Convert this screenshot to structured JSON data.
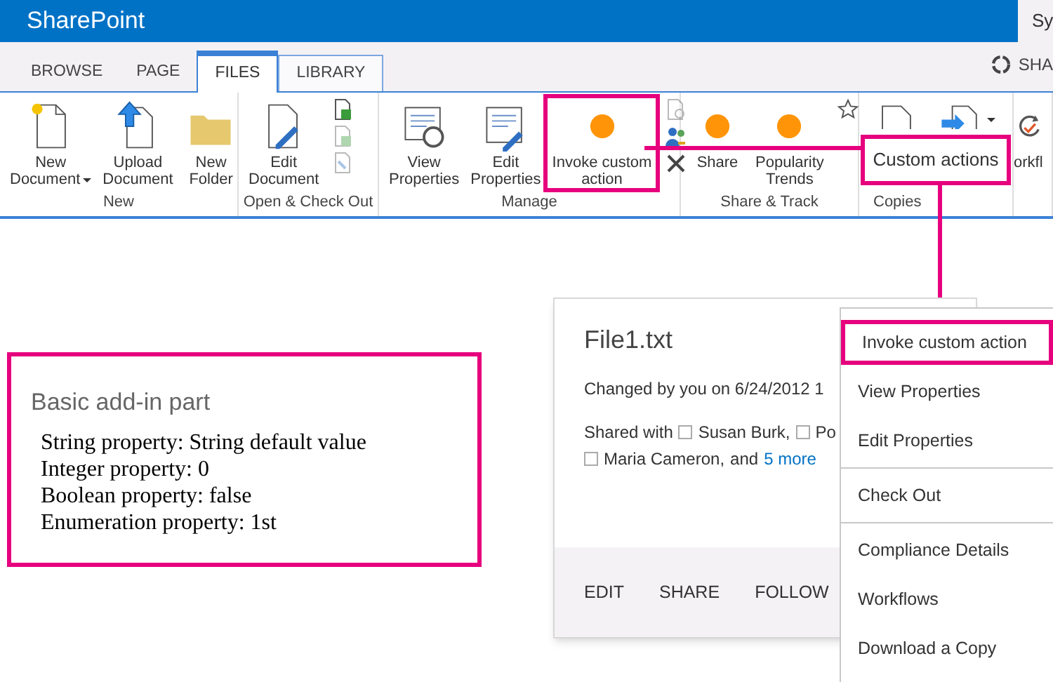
{
  "app_title": "SharePoint",
  "top_right_text": "Sy",
  "tabs": [
    {
      "label": "BROWSE",
      "selected": false
    },
    {
      "label": "PAGE",
      "selected": false
    },
    {
      "label": "FILES",
      "selected": true
    },
    {
      "label": "LIBRARY",
      "selected": false
    }
  ],
  "share_label": "SHA",
  "ribbon": {
    "groups": [
      {
        "label": "New",
        "commands": [
          {
            "kind": "new-document",
            "label": [
              "New",
              "Document"
            ],
            "dropdown": true
          },
          {
            "kind": "upload-document",
            "label": [
              "Upload",
              "Document"
            ]
          },
          {
            "kind": "folder",
            "label": [
              "New",
              "Folder"
            ]
          }
        ]
      },
      {
        "label": "Open & Check Out",
        "commands": [
          {
            "kind": "edit-document",
            "label": [
              "Edit",
              "Document"
            ]
          }
        ],
        "small_commands": [
          {
            "kind": "check-out",
            "disabled": false
          },
          {
            "kind": "check-in",
            "disabled": true
          },
          {
            "kind": "discard",
            "disabled": true
          }
        ]
      },
      {
        "label": "Manage",
        "commands": [
          {
            "kind": "view-properties",
            "label": [
              "View",
              "Properties"
            ]
          },
          {
            "kind": "edit-properties",
            "label": [
              "Edit",
              "Properties"
            ]
          },
          {
            "kind": "custom-action",
            "label": [
              "Invoke custom",
              "action"
            ],
            "callout": true
          }
        ],
        "small_commands": [
          {
            "kind": "version",
            "disabled": true
          },
          {
            "kind": "permissions",
            "disabled": false
          },
          {
            "kind": "delete",
            "disabled": false
          }
        ]
      },
      {
        "label": "Share & Track",
        "commands": [
          {
            "kind": "custom-action",
            "label": [
              "Share"
            ]
          },
          {
            "kind": "custom-action",
            "label": [
              "Popularity",
              "Trends"
            ]
          }
        ],
        "small_commands": [
          {
            "kind": "star",
            "disabled": false
          }
        ]
      },
      {
        "label": "Copies",
        "commands": [
          {
            "kind": "copy-document"
          },
          {
            "kind": "send-to",
            "dropdown": true
          }
        ]
      },
      {
        "commands": [
          {
            "kind": "workflow",
            "label": [
              "orkfl"
            ]
          }
        ]
      }
    ]
  },
  "custom_actions_callout": "Custom actions",
  "addin_part": {
    "title": "Basic add-in part",
    "lines": [
      "String property: String default value",
      "Integer property: 0",
      "Boolean property: false",
      "Enumeration property: 1st"
    ]
  },
  "file_card": {
    "title": "File1.txt",
    "changed": "Changed by you on 6/24/2012 1",
    "shared_label": "Shared with",
    "people": [
      "Susan Burk,",
      "Po"
    ],
    "people_line2": [
      "Maria Cameron,"
    ],
    "and_text": "and",
    "more_link": "5 more",
    "actions": [
      "EDIT",
      "SHARE",
      "FOLLOW"
    ]
  },
  "menu": {
    "items": [
      {
        "label": "Invoke custom action",
        "callout": true,
        "divider_after": false
      },
      {
        "label": "View Properties",
        "callout": false,
        "divider_after": false
      },
      {
        "label": "Edit Properties",
        "callout": false,
        "divider_after": true
      },
      {
        "label": "Check Out",
        "callout": false,
        "divider_after": true
      },
      {
        "label": "Compliance Details",
        "callout": false,
        "divider_after": false
      },
      {
        "label": "Workflows",
        "callout": false,
        "divider_after": false
      },
      {
        "label": "Download a Copy",
        "callout": false,
        "divider_after": false
      }
    ]
  }
}
